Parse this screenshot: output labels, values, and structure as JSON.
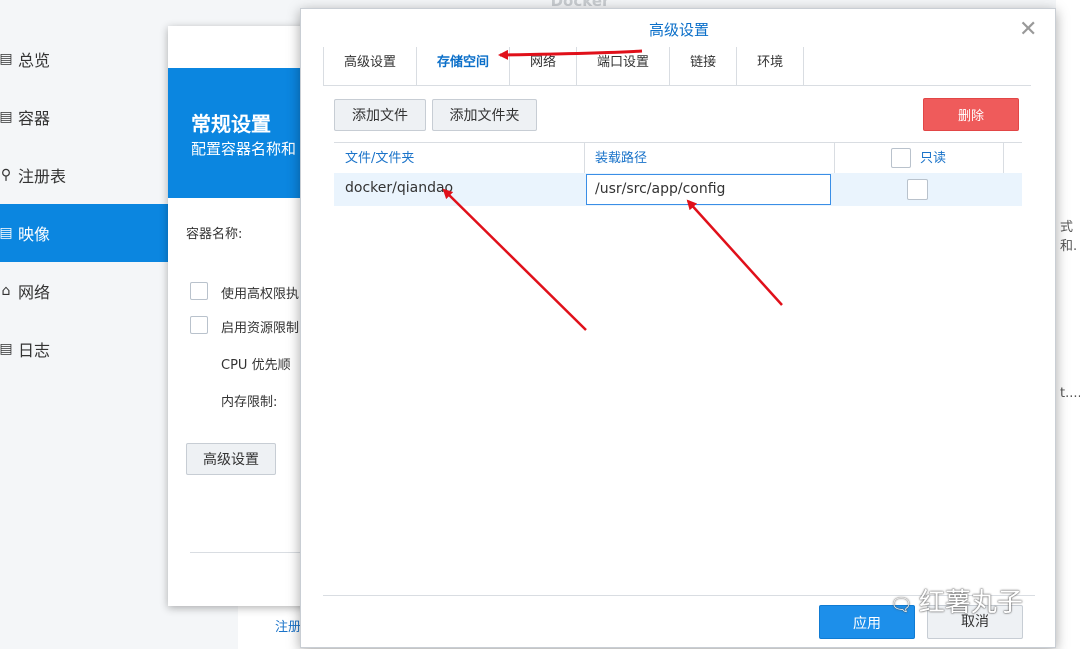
{
  "app": {
    "title": "Docker"
  },
  "sidebar": {
    "items": [
      {
        "label": "总览",
        "icon": "overview-icon"
      },
      {
        "label": "容器",
        "icon": "container-icon"
      },
      {
        "label": "注册表",
        "icon": "registry-icon"
      },
      {
        "label": "映像",
        "icon": "image-icon",
        "active": true
      },
      {
        "label": "网络",
        "icon": "network-icon"
      },
      {
        "label": "日志",
        "icon": "log-icon"
      }
    ]
  },
  "background": {
    "right_text_1": "式和.",
    "right_text_2": "t....",
    "bottom_link": "注册"
  },
  "general_dialog": {
    "heading": "常规设置",
    "subheading": "配置容器名称和",
    "container_name_label": "容器名称:",
    "option_privileged": "使用高权限执",
    "option_resource_limit": "启用资源限制",
    "cpu_priority_label": "CPU 优先顺",
    "memory_limit_label": "内存限制:",
    "advanced_button": "高级设置"
  },
  "advanced_dialog": {
    "title": "高级设置",
    "tabs": [
      {
        "label": "高级设置"
      },
      {
        "label": "存储空间",
        "active": true
      },
      {
        "label": "网络"
      },
      {
        "label": "端口设置"
      },
      {
        "label": "链接"
      },
      {
        "label": "环境"
      }
    ],
    "toolbar": {
      "add_file": "添加文件",
      "add_folder": "添加文件夹",
      "delete": "删除"
    },
    "table": {
      "headers": {
        "file_folder": "文件/文件夹",
        "mount_path": "装载路径",
        "read_only": "只读"
      },
      "rows": [
        {
          "file_folder": "docker/qiandao",
          "mount_path": "/usr/src/app/config",
          "read_only": false
        }
      ]
    },
    "footer": {
      "apply": "应用",
      "cancel": "取消"
    }
  },
  "watermark": {
    "text": "红薯丸子"
  },
  "colors": {
    "accent": "#0b86e0",
    "danger": "#ef5b5b",
    "annotation": "#e0101a"
  }
}
